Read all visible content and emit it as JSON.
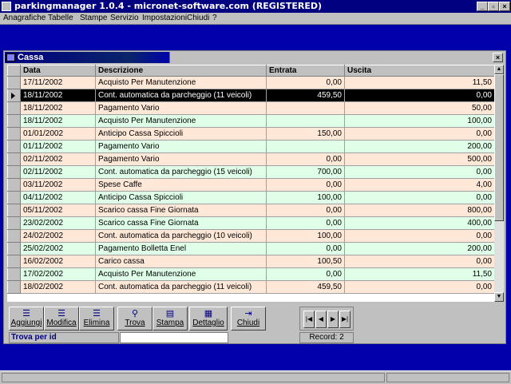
{
  "window": {
    "title": "parkingmanager 1.0.4 - micronet-software.com (REGISTERED)"
  },
  "menu": [
    "Anagrafiche",
    "Tabelle",
    "Stampe",
    "Servizio",
    "Impostazioni",
    "Chiudi",
    "?"
  ],
  "child": {
    "title": "Cassa"
  },
  "grid": {
    "columns": [
      "Data",
      "Descrizione",
      "Entrata",
      "Uscita"
    ],
    "rows": [
      {
        "data": "17/11/2002",
        "descrizione": "Acquisto Per Manutenzione",
        "entrata": "0,00",
        "uscita": "11,50"
      },
      {
        "data": "18/11/2002",
        "descrizione": "Cont. automatica da parcheggio (11 veicoli)",
        "entrata": "459,50",
        "uscita": "0,00"
      },
      {
        "data": "18/11/2002",
        "descrizione": "Pagamento Vario",
        "entrata": "",
        "uscita": "50,00"
      },
      {
        "data": "18/11/2002",
        "descrizione": "Acquisto Per Manutenzione",
        "entrata": "",
        "uscita": "100,00"
      },
      {
        "data": "01/01/2002",
        "descrizione": "Anticipo Cassa Spiccioli",
        "entrata": "150,00",
        "uscita": "0,00"
      },
      {
        "data": "01/11/2002",
        "descrizione": "Pagamento Vario",
        "entrata": "",
        "uscita": "200,00"
      },
      {
        "data": "02/11/2002",
        "descrizione": "Pagamento Vario",
        "entrata": "0,00",
        "uscita": "500,00"
      },
      {
        "data": "02/11/2002",
        "descrizione": "Cont. automatica da parcheggio (15 veicoli)",
        "entrata": "700,00",
        "uscita": "0,00"
      },
      {
        "data": "03/11/2002",
        "descrizione": "Spese Caffe",
        "entrata": "0,00",
        "uscita": "4,00"
      },
      {
        "data": "04/11/2002",
        "descrizione": "Anticipo Cassa Spiccioli",
        "entrata": "100,00",
        "uscita": "0,00"
      },
      {
        "data": "05/11/2002",
        "descrizione": "Scarico cassa Fine Giornata",
        "entrata": "0,00",
        "uscita": "800,00"
      },
      {
        "data": "23/02/2002",
        "descrizione": "Scarico cassa Fine Giornata",
        "entrata": "0,00",
        "uscita": "400,00"
      },
      {
        "data": "24/02/2002",
        "descrizione": "Cont. automatica da parcheggio (10 veicoli)",
        "entrata": "100,00",
        "uscita": "0,00"
      },
      {
        "data": "25/02/2002",
        "descrizione": "Pagamento Bolletta Enel",
        "entrata": "0,00",
        "uscita": "200,00"
      },
      {
        "data": "16/02/2002",
        "descrizione": "Carico cassa",
        "entrata": "100,50",
        "uscita": "0,00"
      },
      {
        "data": "17/02/2002",
        "descrizione": "Acquisto Per Manutenzione",
        "entrata": "0,00",
        "uscita": "11,50"
      },
      {
        "data": "18/02/2002",
        "descrizione": "Cont. automatica da parcheggio (11 veicoli)",
        "entrata": "459,50",
        "uscita": "0,00"
      }
    ],
    "current_row": 1
  },
  "toolbar": {
    "aggiungi": "Aggiungi",
    "modifica": "Modifica",
    "elimina": "Elimina",
    "trova": "Trova",
    "stampa": "Stampa",
    "dettaglio": "Dettaglio",
    "chiudi": "Chiudi"
  },
  "search": {
    "label": "Trova per id",
    "value": ""
  },
  "record": "Record: 2",
  "colors": {
    "peach_row": "#ffe8d8",
    "mint_row": "#e0ffe8",
    "desktop": "#0000aa",
    "titlebar": "#000080"
  }
}
